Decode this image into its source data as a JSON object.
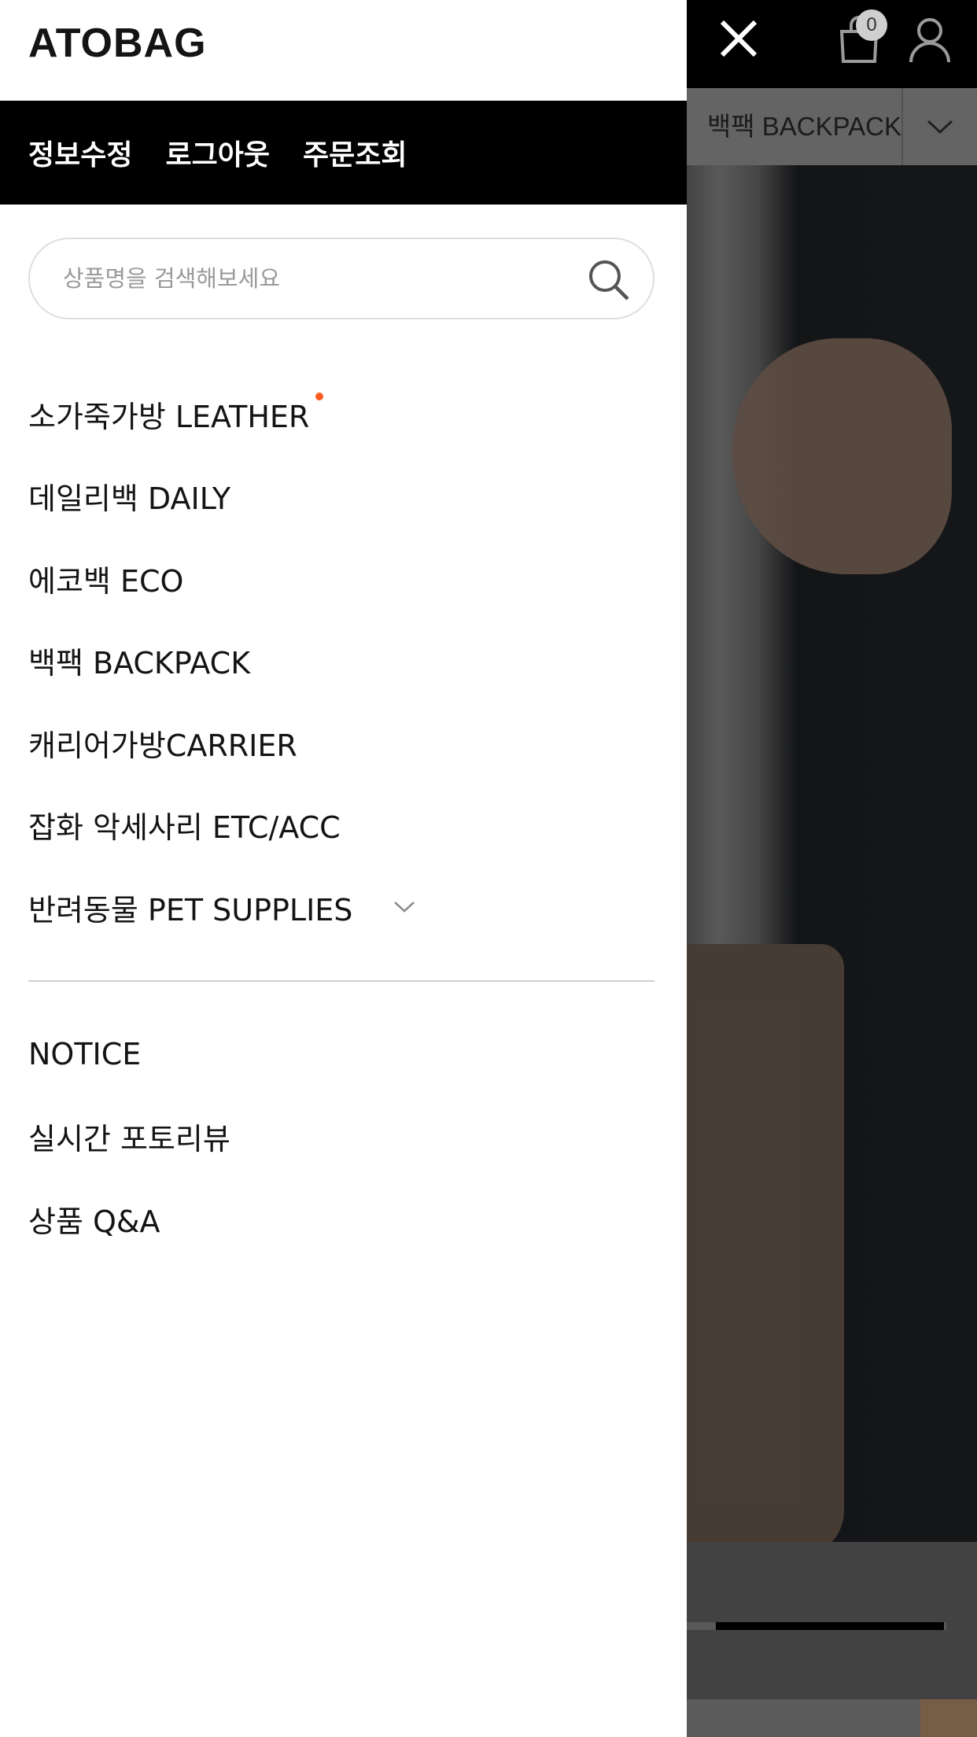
{
  "app": {
    "logo": "ATOBAG"
  },
  "header": {
    "close_icon": "close-icon",
    "cart_icon": "shopping-bag-icon",
    "cart_count": "0",
    "user_icon": "user-icon"
  },
  "background_page": {
    "category_label": "백팩 BACKPACK"
  },
  "account": {
    "links": [
      {
        "label": "정보수정"
      },
      {
        "label": "로그아웃"
      },
      {
        "label": "주문조회"
      }
    ]
  },
  "search": {
    "placeholder": "상품명을 검색해보세요",
    "value": ""
  },
  "categories": [
    {
      "label": "소가죽가방 LEATHER"
    },
    {
      "label": "데일리백 DAILY"
    },
    {
      "label": "에코백 ECO"
    },
    {
      "label": "백팩 BACKPACK"
    },
    {
      "label": "캐리어가방CARRIER"
    },
    {
      "label": "잡화 악세사리 ETC/ACC"
    },
    {
      "label": "반려동물 PET SUPPLIES"
    }
  ],
  "secondary_links": [
    {
      "label": "NOTICE"
    },
    {
      "label": "실시간 포토리뷰"
    },
    {
      "label": "상품 Q&A"
    }
  ],
  "colors": {
    "new_dot": "#ff5a1f",
    "account_bar": "#000000"
  }
}
